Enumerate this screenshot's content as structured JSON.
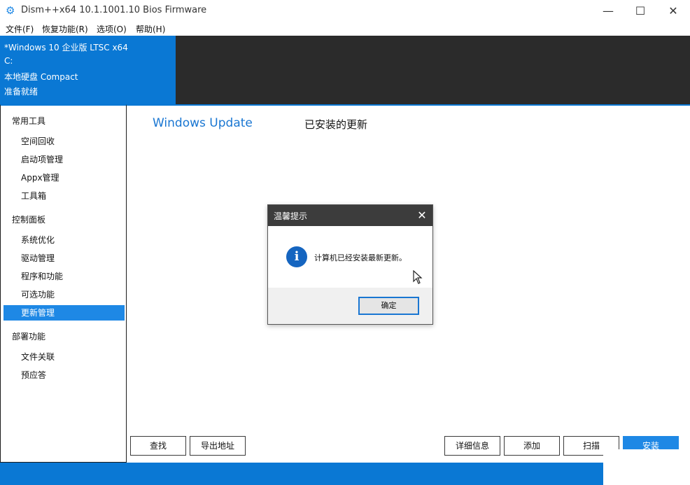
{
  "window": {
    "title": "Dism++x64 10.1.1001.10 Bios Firmware",
    "app_icon": "gear-icon",
    "controls": {
      "minimize": "—",
      "maximize": "☐",
      "close": "✕"
    }
  },
  "menu": [
    "文件(F)",
    "恢复功能(R)",
    "选项(O)",
    "帮助(H)"
  ],
  "info": {
    "os": "*Windows 10 企业版 LTSC x64",
    "drive": "C:",
    "disk": "本地硬盘 Compact",
    "status": "准备就绪"
  },
  "sidebar": {
    "sections": [
      {
        "title": "常用工具",
        "items": [
          "空间回收",
          "启动项管理",
          "Appx管理",
          "工具箱"
        ]
      },
      {
        "title": "控制面板",
        "items": [
          "系统优化",
          "驱动管理",
          "程序和功能",
          "可选功能",
          "更新管理"
        ]
      },
      {
        "title": "部署功能",
        "items": [
          "文件关联",
          "预应答"
        ]
      }
    ],
    "active_item": "更新管理"
  },
  "main": {
    "tab_windows_update": "Windows Update",
    "tab_installed": "已安装的更新",
    "buttons": {
      "find": "查找",
      "export": "导出地址",
      "details": "详细信息",
      "add": "添加",
      "scan": "扫描",
      "install": "安装"
    }
  },
  "dialog": {
    "title": "温馨提示",
    "close": "✕",
    "icon": "info-icon",
    "icon_glyph": "i",
    "message": "计算机已经安装最新更新。",
    "ok": "确定"
  },
  "colors": {
    "accent": "#0a78d4",
    "active_item": "#1e88e5",
    "heading_link": "#1976d2",
    "dark_panel": "#2b2b2b",
    "dialog_title": "#3c3c3c"
  }
}
